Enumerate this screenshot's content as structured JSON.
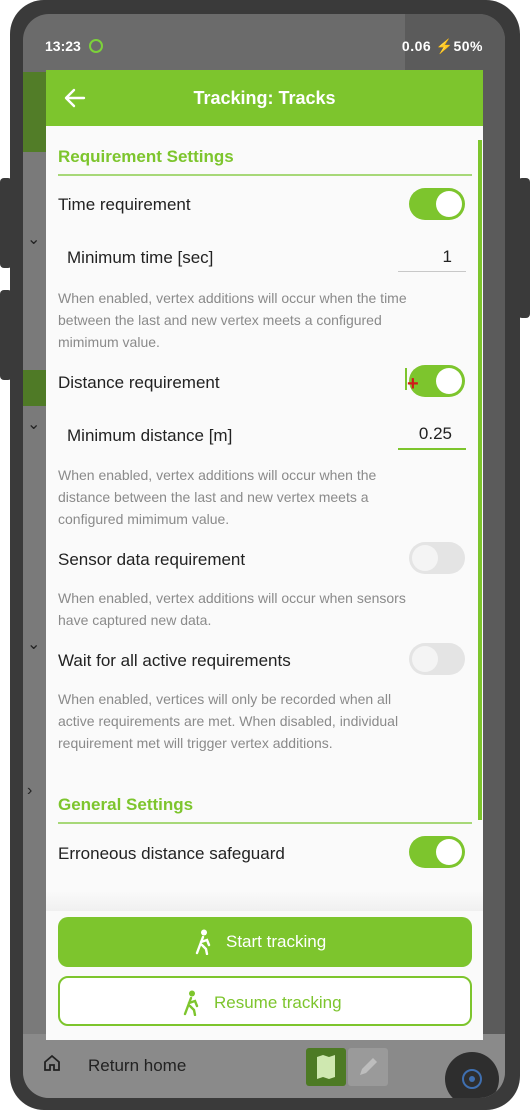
{
  "status_bar": {
    "time": "13:23",
    "right": "0.06 ⚡50%"
  },
  "dialog": {
    "title": "Tracking: Tracks",
    "sections": {
      "requirement_settings": "Requirement Settings",
      "general_settings": "General Settings"
    },
    "time_requirement": {
      "label": "Time requirement",
      "enabled": true,
      "sub_label": "Minimum time [sec]",
      "value": "1",
      "description": "When enabled, vertex additions will occur when the time between the last and new vertex meets a configured mimimum value."
    },
    "distance_requirement": {
      "label": "Distance requirement",
      "enabled": true,
      "sub_label": "Minimum distance [m]",
      "value": "0.25",
      "description": "When enabled, vertex additions will occur when the distance between the last and new vertex meets a configured mimimum value."
    },
    "sensor_requirement": {
      "label": "Sensor data requirement",
      "enabled": false,
      "description": "When enabled, vertex additions will occur when sensors have captured new data."
    },
    "wait_all": {
      "label": "Wait for all active requirements",
      "enabled": false,
      "description": "When enabled, vertices will only be recorded when all active requirements are met. When disabled, individual requirement met will trigger vertex additions."
    },
    "erroneous_distance": {
      "label": "Erroneous distance safeguard",
      "enabled": true
    },
    "buttons": {
      "start": "Start tracking",
      "resume": "Resume tracking"
    }
  },
  "bottom_nav": {
    "home_label": "Return home"
  },
  "colors": {
    "accent": "#7dc52d",
    "description_text": "#8a8a8a"
  }
}
